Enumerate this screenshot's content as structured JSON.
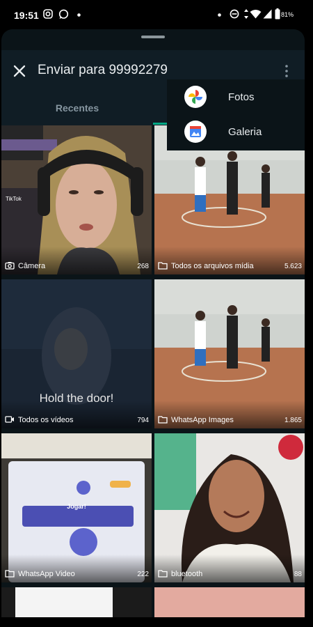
{
  "status": {
    "time": "19:51",
    "battery": "81%"
  },
  "header": {
    "title": "Enviar para 99992279"
  },
  "tabs": [
    {
      "label": "Recentes"
    },
    {
      "label": ""
    }
  ],
  "chooser": [
    {
      "label": "Fotos",
      "icon": "google-photos-icon"
    },
    {
      "label": "Galeria",
      "icon": "gallery-icon"
    }
  ],
  "folders": [
    {
      "name": "Câmera",
      "count": "268",
      "icon": "camera-icon",
      "overlay_text": ""
    },
    {
      "name": "Todos os arquivos mídia",
      "count": "5.623",
      "icon": "folder-icon",
      "overlay_text": ""
    },
    {
      "name": "Todos os vídeos",
      "count": "794",
      "icon": "video-icon",
      "overlay_text": "Hold the door!"
    },
    {
      "name": "WhatsApp Images",
      "count": "1.865",
      "icon": "folder-icon",
      "overlay_text": ""
    },
    {
      "name": "WhatsApp Video",
      "count": "222",
      "icon": "folder-icon",
      "overlay_text": "Jogar!"
    },
    {
      "name": "bluetooth",
      "count": "88",
      "icon": "folder-icon",
      "overlay_text": ""
    }
  ],
  "colors": {
    "accent": "#00a884",
    "sheet_bg": "#0b1418",
    "header_bg": "#101d25"
  }
}
